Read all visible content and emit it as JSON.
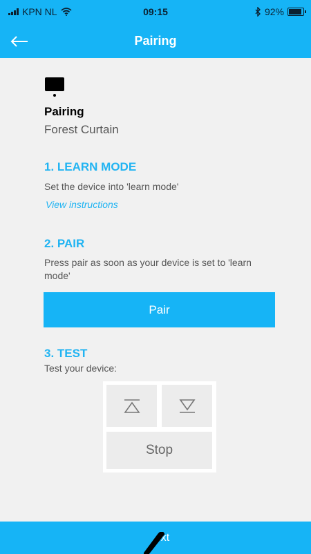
{
  "status_bar": {
    "carrier": "KPN NL",
    "time": "09:15",
    "battery": "92%",
    "battery_level": 0.92
  },
  "header": {
    "title": "Pairing"
  },
  "device": {
    "label": "Pairing",
    "name": "Forest Curtain"
  },
  "steps": {
    "learn": {
      "title": "1. LEARN MODE",
      "text": "Set the device into 'learn mode'",
      "link": "View instructions"
    },
    "pair": {
      "title": "2. PAIR",
      "text": "Press pair as soon as your device is set to 'learn mode'",
      "button": "Pair"
    },
    "test": {
      "title": "3. TEST",
      "text": "Test your device:",
      "stop_label": "Stop"
    }
  },
  "footer": {
    "next_label": "xt"
  },
  "colors": {
    "accent": "#16b4f6",
    "heading": "#21b4f2"
  }
}
